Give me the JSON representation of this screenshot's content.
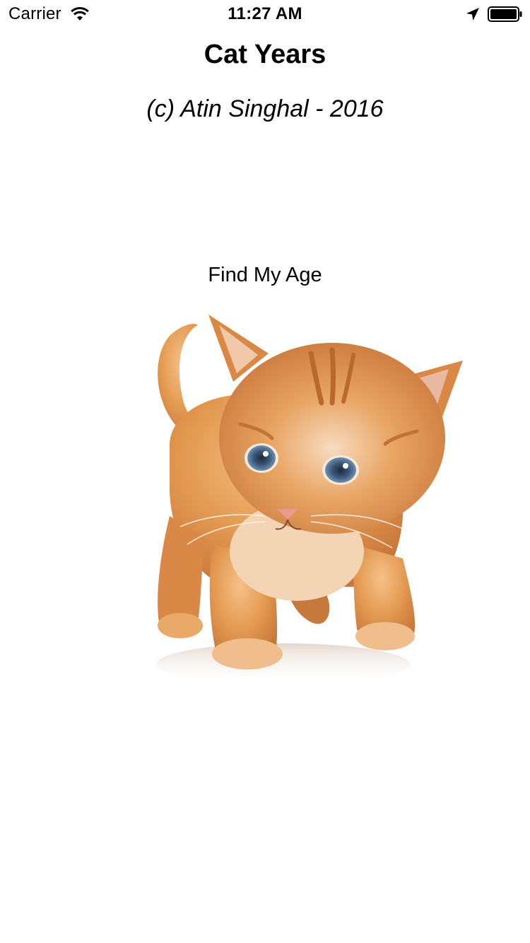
{
  "status_bar": {
    "carrier": "Carrier",
    "time": "11:27 AM",
    "icons": [
      "wifi-icon",
      "location-arrow-icon",
      "battery-icon"
    ]
  },
  "screen": {
    "title": "Cat Years",
    "credit": "(c) Atin Singhal - 2016"
  },
  "actions": {
    "find_age_label": "Find My Age"
  },
  "image": {
    "subject": "kitten-image"
  },
  "colors": {
    "background": "#ffffff",
    "text": "#000000",
    "fur": "#e0964a"
  }
}
